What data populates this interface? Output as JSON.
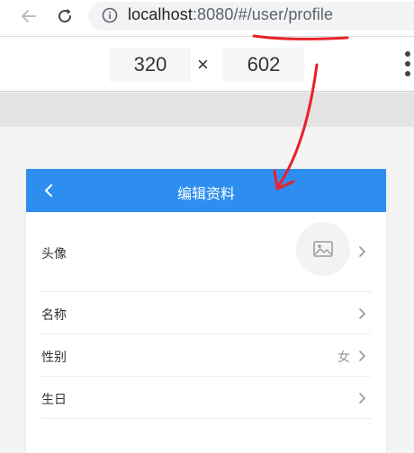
{
  "browser": {
    "url_host": "localhost",
    "url_rest": ":8080/#/user/profile"
  },
  "device_toolbar": {
    "width": "320",
    "times": "×",
    "height": "602"
  },
  "app": {
    "title": "编辑资料",
    "accent_color": "#2d8ef0",
    "annotation_color": "#e8202a",
    "rows": [
      {
        "label": "头像",
        "value": "",
        "icon": "image-placeholder-icon"
      },
      {
        "label": "名称",
        "value": ""
      },
      {
        "label": "性别",
        "value": "女"
      },
      {
        "label": "生日",
        "value": ""
      }
    ]
  }
}
